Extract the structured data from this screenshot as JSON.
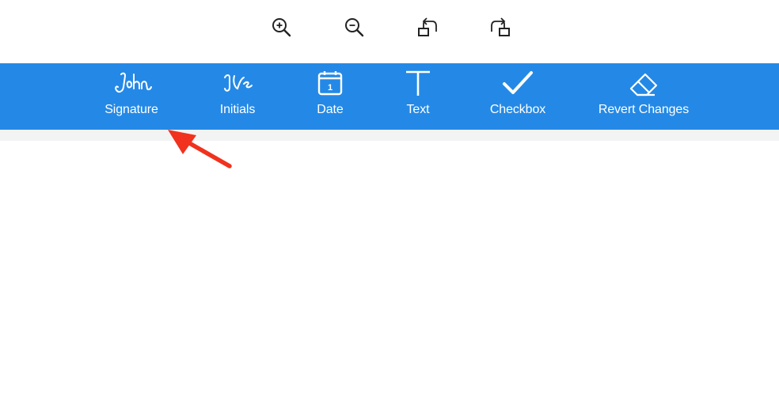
{
  "top_toolbar": {
    "zoom_in_icon": "zoom-in-icon",
    "zoom_out_icon": "zoom-out-icon",
    "rotate_left_icon": "rotate-left-icon",
    "rotate_right_icon": "rotate-right-icon"
  },
  "tools": [
    {
      "label": "Signature",
      "icon": "signature-icon"
    },
    {
      "label": "Initials",
      "icon": "initials-icon"
    },
    {
      "label": "Date",
      "icon": "calendar-icon",
      "calendar_day": "1"
    },
    {
      "label": "Text",
      "icon": "text-icon"
    },
    {
      "label": "Checkbox",
      "icon": "checkmark-icon"
    },
    {
      "label": "Revert Changes",
      "icon": "eraser-icon"
    }
  ],
  "colors": {
    "toolbar_blue": "#2489e6",
    "strip_gray": "#f2f3f3",
    "arrow_red": "#f0321e",
    "icon_dark": "#222222"
  }
}
